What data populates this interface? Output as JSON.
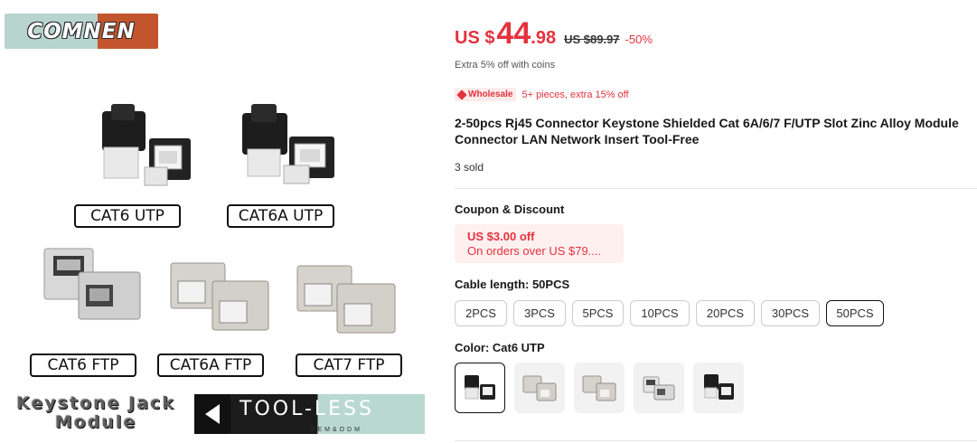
{
  "image": {
    "brand_logo": "COMNEN",
    "labels": [
      "CAT6 UTP",
      "CAT6A UTP",
      "CAT6 FTP",
      "CAT6A FTP",
      "CAT7 FTP"
    ],
    "keystone_line1": "Keystone Jack",
    "keystone_line2": "Module",
    "toolless_label": "TOOL-LESS",
    "toolless_sub": "OEM&ODM"
  },
  "price": {
    "currency": "US $",
    "integer": "44",
    "decimal": ".98",
    "original": "US $89.97",
    "discount": "-50%"
  },
  "coins_text": "Extra 5% off with coins",
  "wholesale": {
    "badge": "Wholesale",
    "text": "5+ pieces, extra 15% off"
  },
  "title": "2-50pcs Rj45 Connector Keystone Shielded Cat 6A/6/7 F/UTP Slot Zinc Alloy Module Connector LAN Network Insert Tool-Free",
  "sold": "3 sold",
  "coupon": {
    "heading": "Coupon & Discount",
    "amount": "US $3.00 off",
    "condition": "On orders over US $79...."
  },
  "cable_length": {
    "label": "Cable length: 50PCS",
    "options": [
      "2PCS",
      "3PCS",
      "5PCS",
      "10PCS",
      "20PCS",
      "30PCS",
      "50PCS"
    ],
    "selected": "50PCS"
  },
  "color": {
    "label": "Color: Cat6 UTP",
    "swatches": [
      "cat6-utp-swatch",
      "cat6a-ftp-swatch",
      "cat7-ftp-swatch",
      "cat6-ftp-swatch",
      "cat6a-utp-swatch"
    ],
    "selected_index": 0
  },
  "colors": {
    "accent": "#e4323e",
    "coupon_bg": "#fff0f0",
    "border": "#cccccc"
  }
}
